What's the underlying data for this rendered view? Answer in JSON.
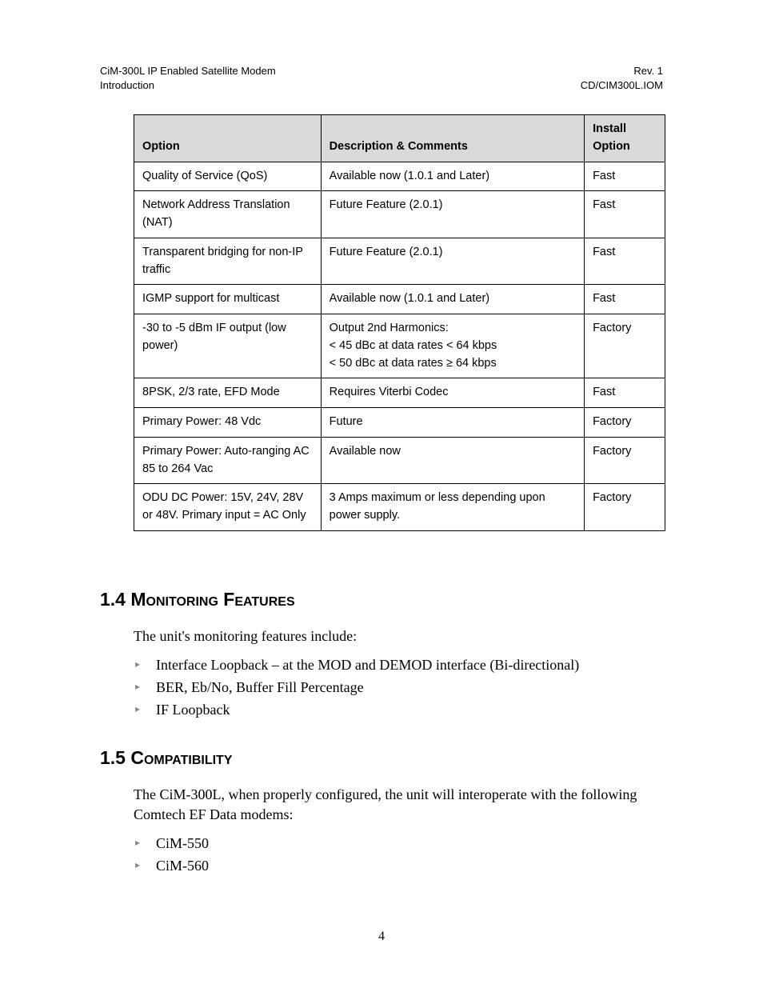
{
  "header": {
    "left_line1": "CiM-300L IP Enabled Satellite Modem",
    "left_line2": "Introduction",
    "right_line1": "Rev. 1",
    "right_line2": "CD/CIM300L.IOM"
  },
  "table_headers": {
    "option": "Option",
    "description": "Description & Comments",
    "install": "Install Option"
  },
  "rows": [
    {
      "option": "Quality of Service (QoS)",
      "description": "Available now (1.0.1 and Later)",
      "install": "Fast"
    },
    {
      "option": "Network Address Translation (NAT)",
      "description": "Future Feature (2.0.1)",
      "install": "Fast"
    },
    {
      "option": "Transparent bridging for non-IP traffic",
      "description": "Future Feature (2.0.1)",
      "install": "Fast"
    },
    {
      "option": "IGMP support for multicast",
      "description": "Available now (1.0.1 and Later)",
      "install": "Fast"
    },
    {
      "option": "-30 to -5 dBm IF output (low power)",
      "description": "Output 2nd Harmonics:\n< 45 dBc at data rates < 64 kbps\n< 50 dBc at data rates ≥ 64 kbps",
      "install": "Factory"
    },
    {
      "option": "8PSK, 2/3 rate, EFD Mode",
      "description": "Requires Viterbi Codec",
      "install": "Fast"
    },
    {
      "option": "Primary Power: 48 Vdc",
      "description": "Future",
      "install": "Factory"
    },
    {
      "option": "Primary Power: Auto-ranging AC 85 to 264 Vac",
      "description": "Available now",
      "install": "Factory"
    },
    {
      "option": "ODU DC Power: 15V, 24V, 28V or 48V. Primary input = AC Only",
      "description": "3 Amps maximum or less depending upon power supply.",
      "install": "Factory"
    }
  ],
  "section_1_4": {
    "number": "1.4",
    "title": "Monitoring Features",
    "intro": "The unit's monitoring features include:",
    "items": [
      "Interface Loopback – at the MOD and DEMOD interface (Bi-directional)",
      "BER, Eb/No, Buffer Fill Percentage",
      "IF Loopback"
    ]
  },
  "section_1_5": {
    "number": "1.5",
    "title": "Compatibility",
    "intro": "The CiM-300L, when properly configured, the unit will interoperate with the following Comtech EF Data modems:",
    "items": [
      "CiM-550",
      "CiM-560"
    ]
  },
  "page_number": "4"
}
